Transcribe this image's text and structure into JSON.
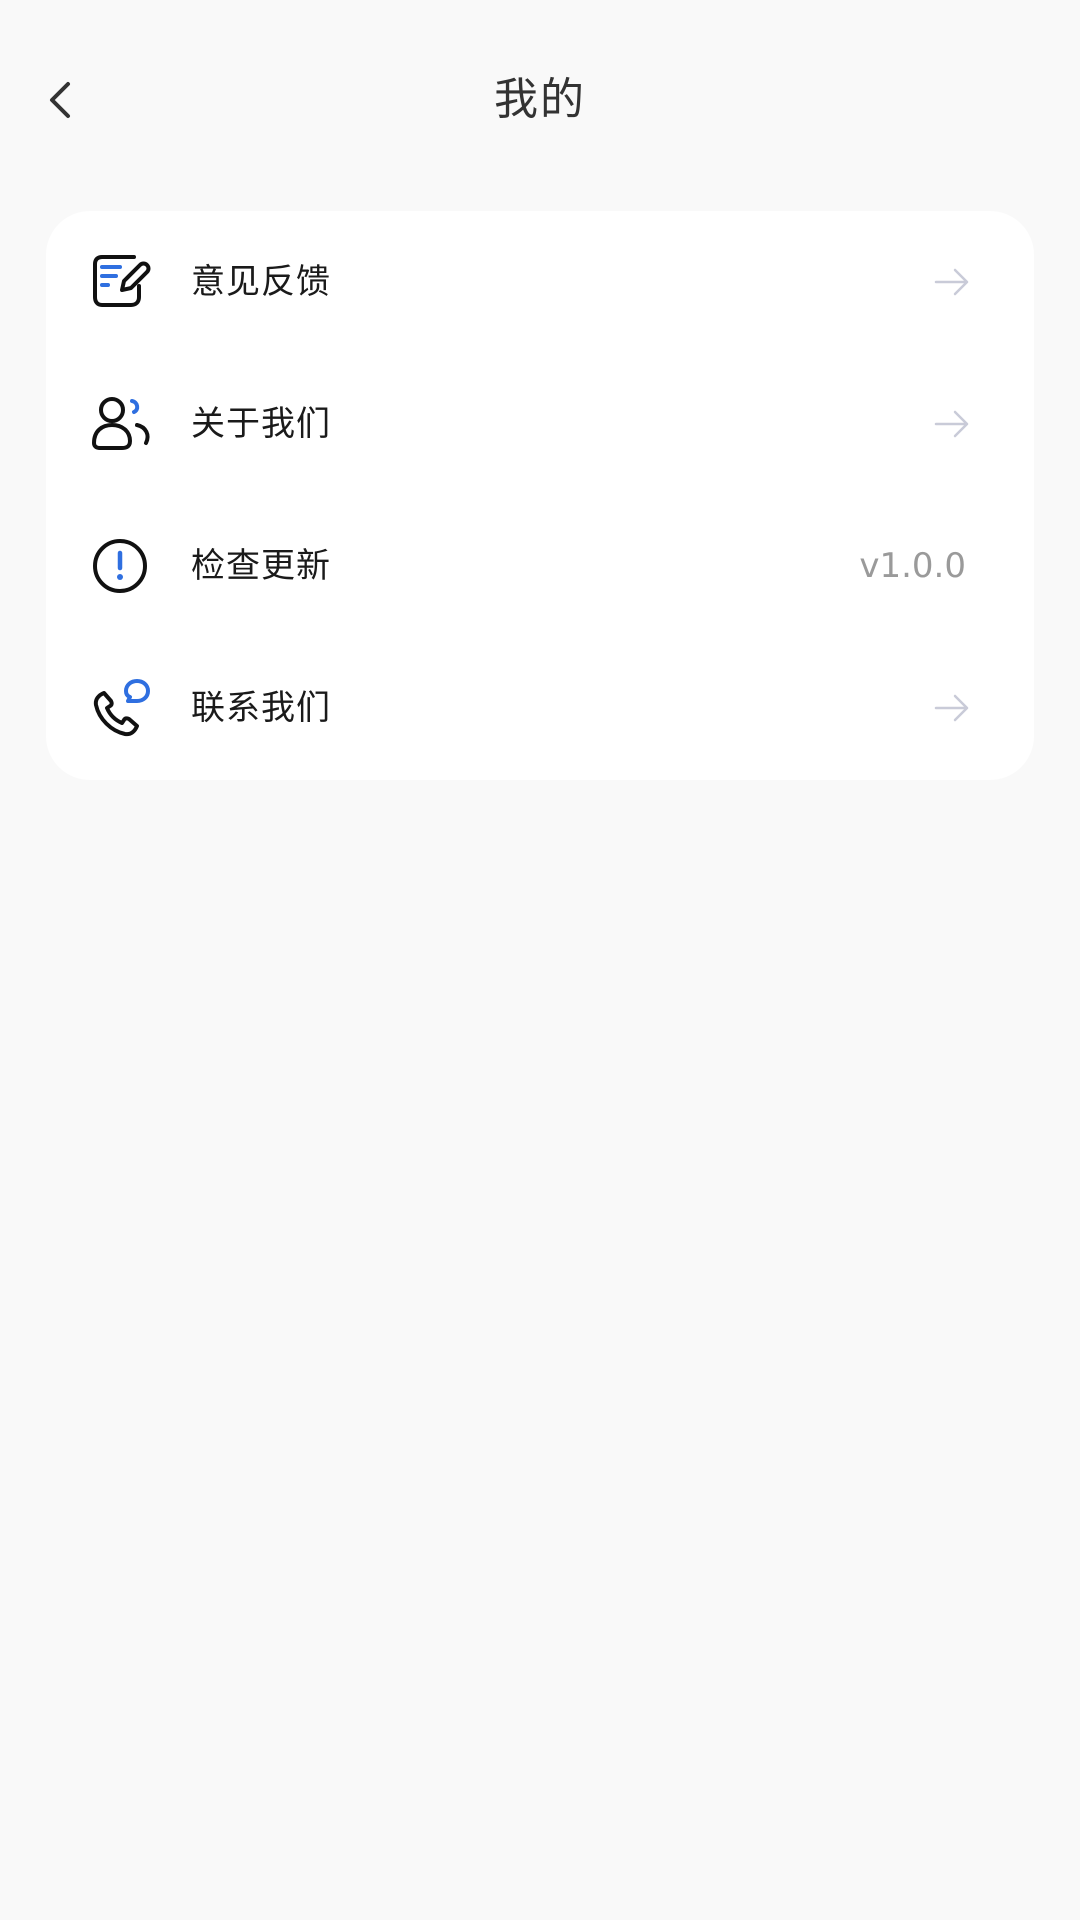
{
  "header": {
    "title": "我的"
  },
  "menu": {
    "items": [
      {
        "label": "意见反馈",
        "icon": "feedback-edit-icon",
        "trailing": "arrow-right-icon"
      },
      {
        "label": "关于我们",
        "icon": "about-users-icon",
        "trailing": "arrow-right-icon"
      },
      {
        "label": "检查更新",
        "icon": "info-alert-icon",
        "value": "v1.0.0"
      },
      {
        "label": "联系我们",
        "icon": "phone-chat-icon",
        "trailing": "arrow-right-icon"
      }
    ]
  },
  "colors": {
    "background": "#f9f9f9",
    "card": "#ffffff",
    "accent": "#2f6fe0",
    "arrow": "#c9cbd8"
  }
}
